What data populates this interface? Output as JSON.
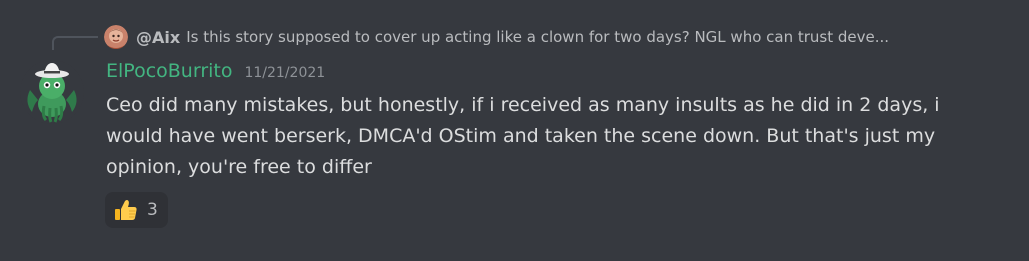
{
  "reply": {
    "author": "@Aix",
    "text": "Is this story supposed to cover up acting like a clown for two days? NGL who can trust deve..."
  },
  "message": {
    "username": "ElPocoBurrito",
    "timestamp": "11/21/2021",
    "content": "Ceo did many mistakes, but honestly, if i received as many insults as he did in 2 days, i would have went berserk, DMCA'd OStim and taken the scene down. But that's just my opinion, you're free to differ",
    "reaction": {
      "emoji": "thumbs-up-icon",
      "count": "3"
    }
  },
  "colors": {
    "background": "#36393f",
    "username": "#43b581",
    "text": "#dcddde",
    "muted": "#b9bbbe",
    "timestamp": "#8e9297",
    "reaction_bg": "#2f3136"
  }
}
